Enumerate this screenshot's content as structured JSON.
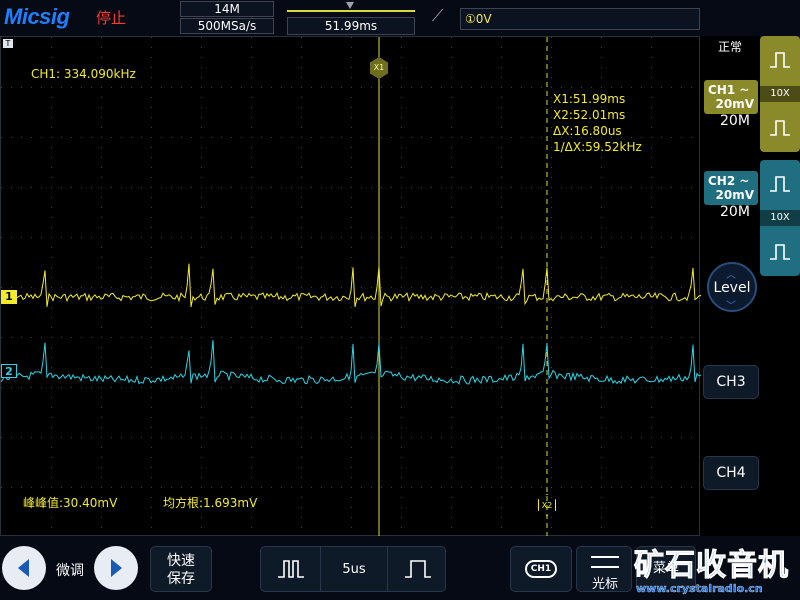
{
  "top_bar": {
    "brand": "Micsig",
    "run_state": "停止",
    "memory_depth": "14M",
    "sample_rate": "500MSa/s",
    "trigger_time": "51.99ms",
    "trigger_edge_icon": "rising-edge-icon",
    "trigger_level": "①0V"
  },
  "screen": {
    "frequency_readout": "CH1: 334.090kHz",
    "cursor_readout": [
      "X1:51.99ms",
      "X2:52.01ms",
      "ΔX:16.80us",
      "1/ΔX:59.52kHz"
    ],
    "peak_to_peak": "峰峰值:30.40mV",
    "rms": "均方根:1.693mV",
    "ch1_marker": "1",
    "ch2_marker": "2",
    "cursor_x1_label": "X1",
    "cursor_x2_label": "X2"
  },
  "right_panel": {
    "status": "正常",
    "ch1": {
      "name": "CH1",
      "coupling": "~",
      "scale": "20mV",
      "timebase": "20M",
      "probe_ratio": "10X",
      "color": "#f3ea2c"
    },
    "ch2": {
      "name": "CH2",
      "coupling": "~",
      "scale": "20mV",
      "timebase": "20M",
      "probe_ratio": "10X",
      "color": "#28d4e6"
    },
    "level_label": "Level",
    "ch3_label": "CH3",
    "ch4_label": "CH4"
  },
  "bottom_bar": {
    "fine_label": "微调",
    "fast_save_line1": "快速",
    "fast_save_line2": "保存",
    "timebase": "5us",
    "ch1_select": "CH1",
    "cursor_label": "光标",
    "menu_label": "菜单"
  },
  "watermark": {
    "main": "矿石收音机",
    "url": "www.crystalradio.cn"
  }
}
